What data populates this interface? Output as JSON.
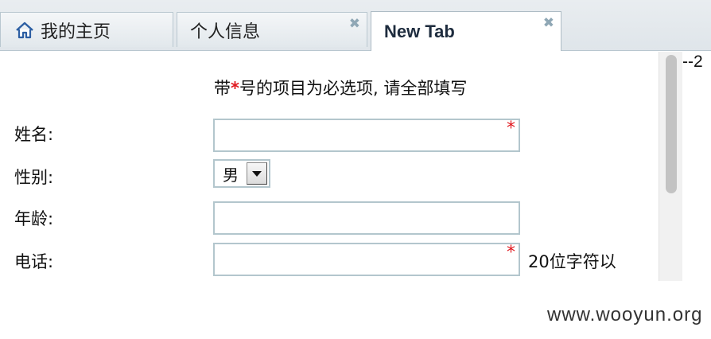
{
  "tabs": [
    {
      "label": "我的主页",
      "icon": "home-icon",
      "closable": false,
      "active": false
    },
    {
      "label": "个人信息",
      "closable": true,
      "active": false
    },
    {
      "label": "New Tab",
      "closable": true,
      "active": true
    }
  ],
  "close_glyph": "✖",
  "form": {
    "notice_prefix": "带",
    "notice_star": "*",
    "notice_suffix": "号的项目为必选项, 请全部填写",
    "required_mark": "*",
    "fields": {
      "name": {
        "label": "姓名:",
        "value": "",
        "required": true
      },
      "gender": {
        "label": "性别:",
        "value": "男"
      },
      "age": {
        "label": "年龄:",
        "value": ""
      },
      "phone": {
        "label": "电话:",
        "value": "",
        "required": true,
        "hint": "20位字符以"
      }
    }
  },
  "edge_text": "--2",
  "watermark": "www.wooyun.org",
  "colors": {
    "required": "#e0191f",
    "input_border": "#b3c6cd",
    "tab_active_text": "#1e2c3e"
  }
}
